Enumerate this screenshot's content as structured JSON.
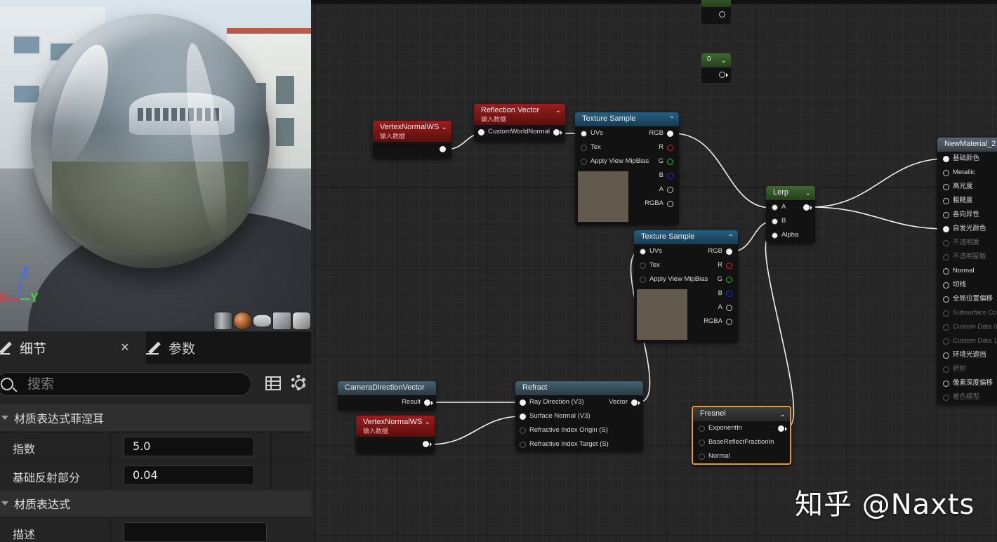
{
  "viewport": {
    "axes": {
      "x": "X",
      "y": "Y",
      "z": "Z"
    },
    "preview_shapes": [
      "cylinder-icon",
      "sphere-icon",
      "plane-icon",
      "cube-icon",
      "teapot-icon"
    ]
  },
  "details_panel": {
    "tabs": [
      {
        "label": "细节",
        "icon": "pencil-icon",
        "active": true,
        "close": "×"
      },
      {
        "label": "参数",
        "icon": "pencil-icon",
        "active": false
      }
    ],
    "search": {
      "placeholder": "搜索"
    },
    "sections": [
      {
        "title": "材质表达式菲涅耳",
        "properties": [
          {
            "label": "指数",
            "value": "5.0"
          },
          {
            "label": "基础反射部分",
            "value": "0.04"
          }
        ]
      },
      {
        "title": "材质表达式",
        "properties": [
          {
            "label": "描述",
            "value": ""
          }
        ]
      }
    ]
  },
  "graph": {
    "nodes": {
      "vertex_normal_1": {
        "title": "VertexNormalWS",
        "subtitle": "输入数据"
      },
      "reflection_vector": {
        "title": "Reflection Vector",
        "subtitle": "输入数据",
        "inputs": [
          "CustomWorldNormal"
        ]
      },
      "texture_sample_1": {
        "title": "Texture Sample",
        "inputs": [
          "UVs",
          "Tex",
          "Apply View MipBias"
        ],
        "outputs": [
          "RGB",
          "R",
          "G",
          "B",
          "A",
          "RGBA"
        ]
      },
      "texture_sample_2": {
        "title": "Texture Sample",
        "inputs": [
          "UVs",
          "Tex",
          "Apply View MipBias"
        ],
        "outputs": [
          "RGB",
          "R",
          "G",
          "B",
          "A",
          "RGBA"
        ]
      },
      "lerp": {
        "title": "Lerp",
        "inputs": [
          "A",
          "B",
          "Alpha"
        ]
      },
      "camera_direction": {
        "title": "CameraDirectionVector",
        "outputs": [
          "Result"
        ]
      },
      "vertex_normal_2": {
        "title": "VertexNormalWS",
        "subtitle": "输入数据"
      },
      "refract": {
        "title": "Refract",
        "inputs": [
          "Ray Direction (V3)",
          "Surface Normal (V3)",
          "Refractive Index Origin (S)",
          "Refractive Index Target (S)"
        ],
        "outputs": [
          "Vector"
        ]
      },
      "fresnel": {
        "title": "Fresnel",
        "inputs": [
          "ExponentIn",
          "BaseReflectFractionIn",
          "Normal"
        ]
      },
      "constant_0": {
        "title": "0"
      },
      "material": {
        "title": "NewMaterial_2",
        "inputs": [
          {
            "label": "基础颜色",
            "enabled": true
          },
          {
            "label": "Metallic",
            "enabled": true
          },
          {
            "label": "高光度",
            "enabled": true
          },
          {
            "label": "粗糙度",
            "enabled": true
          },
          {
            "label": "各向异性",
            "enabled": true
          },
          {
            "label": "自发光颜色",
            "enabled": true
          },
          {
            "label": "不透明度",
            "enabled": false
          },
          {
            "label": "不透明蒙版",
            "enabled": false
          },
          {
            "label": "Normal",
            "enabled": true
          },
          {
            "label": "切线",
            "enabled": true
          },
          {
            "label": "全局位置偏移",
            "enabled": true
          },
          {
            "label": "Subsurface Col",
            "enabled": false
          },
          {
            "label": "Custom Data 0",
            "enabled": false
          },
          {
            "label": "Custom Data 1",
            "enabled": false
          },
          {
            "label": "环境光遮挡",
            "enabled": true
          },
          {
            "label": "折射",
            "enabled": false
          },
          {
            "label": "像素深度偏移",
            "enabled": true
          },
          {
            "label": "着色模型",
            "enabled": false
          }
        ]
      }
    }
  },
  "watermark": "知乎 @Naxts",
  "colors": {
    "accent_selected": "#e8962e",
    "wire": "#f0f0f0"
  }
}
